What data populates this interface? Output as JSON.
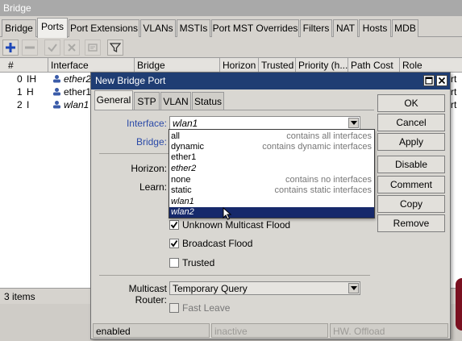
{
  "window": {
    "title": "Bridge"
  },
  "main_tabs": [
    {
      "label": "Bridge",
      "active": false
    },
    {
      "label": "Ports",
      "active": true
    },
    {
      "label": "Port Extensions",
      "active": false
    },
    {
      "label": "VLANs",
      "active": false
    },
    {
      "label": "MSTIs",
      "active": false
    },
    {
      "label": "Port MST Overrides",
      "active": false
    },
    {
      "label": "Filters",
      "active": false
    },
    {
      "label": "NAT",
      "active": false
    },
    {
      "label": "Hosts",
      "active": false
    },
    {
      "label": "MDB",
      "active": false
    }
  ],
  "toolbar": {
    "icons": [
      "plus-icon",
      "minus-icon",
      "check-icon",
      "cross-icon",
      "comment-icon",
      "filter-icon"
    ]
  },
  "table": {
    "columns": [
      "#",
      "Interface",
      "Bridge",
      "Horizon",
      "Trusted",
      "Priority (h...",
      "Path Cost",
      "Role"
    ],
    "rows": [
      {
        "num": "0",
        "flags": "IH",
        "interface": "ether2",
        "iface_italic": true,
        "role": "rt"
      },
      {
        "num": "1",
        "flags": "H",
        "interface": "ether1",
        "iface_italic": false,
        "role": "rt"
      },
      {
        "num": "2",
        "flags": "I",
        "interface": "wlan1",
        "iface_italic": true,
        "role": "rt"
      }
    ]
  },
  "status": {
    "items": "3 items"
  },
  "dialog": {
    "title": "New Bridge Port",
    "tabs": [
      {
        "label": "General",
        "active": true
      },
      {
        "label": "STP",
        "active": false
      },
      {
        "label": "VLAN",
        "active": false
      },
      {
        "label": "Status",
        "active": false
      }
    ],
    "labels": {
      "interface": "Interface:",
      "bridge": "Bridge:",
      "horizon": "Horizon:",
      "learn": "Learn:",
      "multicast_router": "Multicast Router:"
    },
    "interface_value": "wlan1",
    "multicast_router_value": "Temporary Query",
    "checkboxes": {
      "unknown_multicast_flood": {
        "label": "Unknown Multicast Flood",
        "checked": true
      },
      "broadcast_flood": {
        "label": "Broadcast Flood",
        "checked": true
      },
      "trusted": {
        "label": "Trusted",
        "checked": false
      },
      "fast_leave": {
        "label": "Fast Leave",
        "checked": false
      }
    },
    "buttons": [
      "OK",
      "Cancel",
      "Apply",
      "Disable",
      "Comment",
      "Copy",
      "Remove"
    ],
    "statusbar": [
      "enabled",
      "inactive",
      "HW. Offload"
    ]
  },
  "dropdown": {
    "options": [
      {
        "label": "all",
        "desc": "contains all interfaces",
        "italic": false,
        "selected": false
      },
      {
        "label": "dynamic",
        "desc": "contains dynamic interfaces",
        "italic": false,
        "selected": false
      },
      {
        "label": "ether1",
        "desc": "",
        "italic": false,
        "selected": false
      },
      {
        "label": "ether2",
        "desc": "",
        "italic": true,
        "selected": false
      },
      {
        "label": "none",
        "desc": "contains no interfaces",
        "italic": false,
        "selected": false
      },
      {
        "label": "static",
        "desc": "contains static interfaces",
        "italic": false,
        "selected": false
      },
      {
        "label": "wlan1",
        "desc": "",
        "italic": true,
        "selected": false
      },
      {
        "label": "wlan2",
        "desc": "",
        "italic": true,
        "selected": true
      }
    ]
  },
  "colors": {
    "dialog_title_bg": "#1f3d73",
    "selection_bg": "#16296b",
    "field_label_blue": "#2b4aa8",
    "add_icon_blue": "#1d47b8"
  }
}
